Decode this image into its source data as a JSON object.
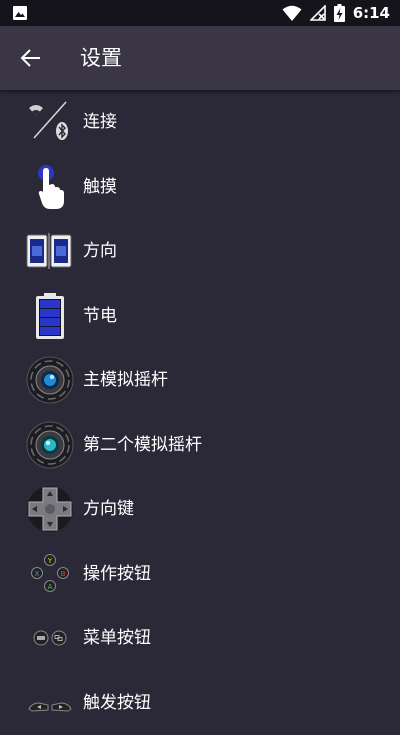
{
  "status_bar": {
    "time": "6:14",
    "icons": [
      "image-icon",
      "wifi-icon",
      "no-signal-icon",
      "battery-charging-icon"
    ]
  },
  "header": {
    "back_icon": "arrow-left-icon",
    "title": "设置"
  },
  "settings": {
    "items": [
      {
        "label": "连接",
        "icon": "wifi-bluetooth-icon"
      },
      {
        "label": "触摸",
        "icon": "touch-hand-icon"
      },
      {
        "label": "方向",
        "icon": "phone-orientation-icon"
      },
      {
        "label": "节电",
        "icon": "battery-saver-icon"
      },
      {
        "label": "主模拟摇杆",
        "icon": "analog-stick-icon"
      },
      {
        "label": "第二个模拟摇杆",
        "icon": "second-analog-stick-icon"
      },
      {
        "label": "方向键",
        "icon": "dpad-icon"
      },
      {
        "label": "操作按钮",
        "icon": "action-buttons-icon"
      },
      {
        "label": "菜单按钮",
        "icon": "menu-buttons-icon"
      },
      {
        "label": "触发按钮",
        "icon": "trigger-buttons-icon"
      }
    ]
  },
  "colors": {
    "background": "#2b2838",
    "app_bar": "#3a3645",
    "status_bar": "#15141b",
    "accent_blue": "#2a36c8"
  }
}
